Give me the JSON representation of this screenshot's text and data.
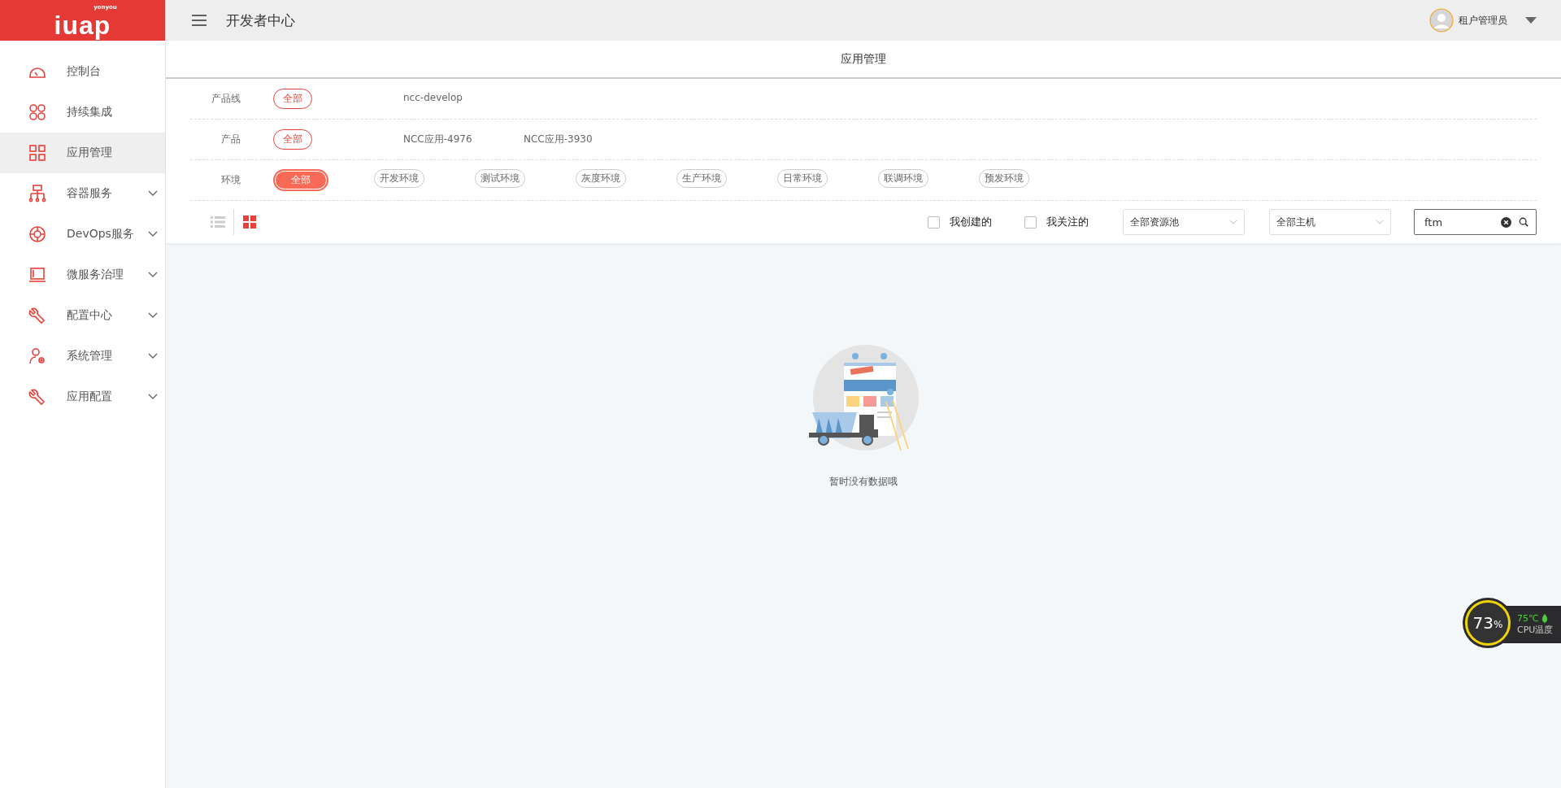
{
  "logo": {
    "brand": "iuap",
    "sub": "yonyou"
  },
  "header": {
    "title": "开发者中心",
    "user": "租户管理员"
  },
  "sidebar": {
    "items": [
      {
        "label": "控制台",
        "expandable": false,
        "selected": false
      },
      {
        "label": "持续集成",
        "expandable": false,
        "selected": false
      },
      {
        "label": "应用管理",
        "expandable": false,
        "selected": true
      },
      {
        "label": "容器服务",
        "expandable": true,
        "selected": false
      },
      {
        "label": "DevOps服务",
        "expandable": true,
        "selected": false
      },
      {
        "label": "微服务治理",
        "expandable": true,
        "selected": false
      },
      {
        "label": "配置中心",
        "expandable": true,
        "selected": false
      },
      {
        "label": "系统管理",
        "expandable": true,
        "selected": false
      },
      {
        "label": "应用配置",
        "expandable": true,
        "selected": false
      }
    ]
  },
  "page_title": "应用管理",
  "filters": [
    {
      "label": "产品线",
      "kind": "text",
      "options": [
        {
          "label": "全部",
          "selected": true
        },
        {
          "label": "ncc-develop",
          "selected": false
        }
      ]
    },
    {
      "label": "产品",
      "kind": "text",
      "options": [
        {
          "label": "全部",
          "selected": true
        },
        {
          "label": "NCC应用-4976",
          "selected": false
        },
        {
          "label": "NCC应用-3930",
          "selected": false
        }
      ]
    },
    {
      "label": "环境",
      "kind": "chip",
      "options": [
        {
          "label": "全部",
          "selected": true
        },
        {
          "label": "开发环境",
          "selected": false
        },
        {
          "label": "测试环境",
          "selected": false
        },
        {
          "label": "灰度环境",
          "selected": false
        },
        {
          "label": "生产环境",
          "selected": false
        },
        {
          "label": "日常环境",
          "selected": false
        },
        {
          "label": "联调环境",
          "selected": false
        },
        {
          "label": "预发环境",
          "selected": false
        }
      ]
    }
  ],
  "toolbar": {
    "views": [
      {
        "kind": "list",
        "selected": false
      },
      {
        "kind": "grid",
        "selected": true
      }
    ],
    "checkboxes": [
      {
        "label": "我创建的",
        "checked": false
      },
      {
        "label": "我关注的",
        "checked": false
      }
    ],
    "selects": [
      "全部资源池",
      "全部主机"
    ],
    "search": {
      "value": "ftm"
    }
  },
  "empty_message": "暂时没有数据哦",
  "cpu_widget": {
    "percent": "73",
    "unit": "%",
    "temp": "75℃",
    "label": "CPU温度"
  }
}
